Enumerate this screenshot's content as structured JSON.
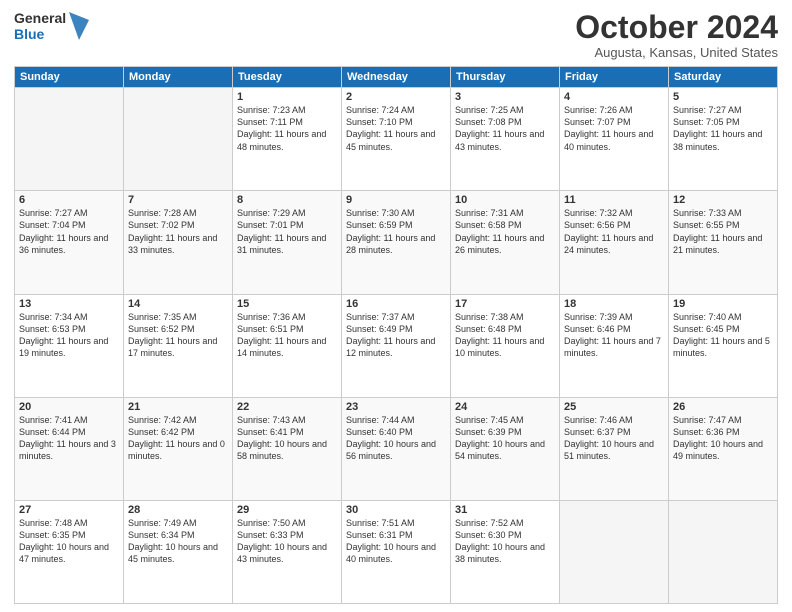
{
  "logo": {
    "line1": "General",
    "line2": "Blue"
  },
  "title": "October 2024",
  "location": "Augusta, Kansas, United States",
  "days_of_week": [
    "Sunday",
    "Monday",
    "Tuesday",
    "Wednesday",
    "Thursday",
    "Friday",
    "Saturday"
  ],
  "weeks": [
    [
      {
        "num": "",
        "empty": true
      },
      {
        "num": "",
        "empty": true
      },
      {
        "num": "1",
        "sunrise": "7:23 AM",
        "sunset": "7:11 PM",
        "daylight": "11 hours and 48 minutes."
      },
      {
        "num": "2",
        "sunrise": "7:24 AM",
        "sunset": "7:10 PM",
        "daylight": "11 hours and 45 minutes."
      },
      {
        "num": "3",
        "sunrise": "7:25 AM",
        "sunset": "7:08 PM",
        "daylight": "11 hours and 43 minutes."
      },
      {
        "num": "4",
        "sunrise": "7:26 AM",
        "sunset": "7:07 PM",
        "daylight": "11 hours and 40 minutes."
      },
      {
        "num": "5",
        "sunrise": "7:27 AM",
        "sunset": "7:05 PM",
        "daylight": "11 hours and 38 minutes."
      }
    ],
    [
      {
        "num": "6",
        "sunrise": "7:27 AM",
        "sunset": "7:04 PM",
        "daylight": "11 hours and 36 minutes."
      },
      {
        "num": "7",
        "sunrise": "7:28 AM",
        "sunset": "7:02 PM",
        "daylight": "11 hours and 33 minutes."
      },
      {
        "num": "8",
        "sunrise": "7:29 AM",
        "sunset": "7:01 PM",
        "daylight": "11 hours and 31 minutes."
      },
      {
        "num": "9",
        "sunrise": "7:30 AM",
        "sunset": "6:59 PM",
        "daylight": "11 hours and 28 minutes."
      },
      {
        "num": "10",
        "sunrise": "7:31 AM",
        "sunset": "6:58 PM",
        "daylight": "11 hours and 26 minutes."
      },
      {
        "num": "11",
        "sunrise": "7:32 AM",
        "sunset": "6:56 PM",
        "daylight": "11 hours and 24 minutes."
      },
      {
        "num": "12",
        "sunrise": "7:33 AM",
        "sunset": "6:55 PM",
        "daylight": "11 hours and 21 minutes."
      }
    ],
    [
      {
        "num": "13",
        "sunrise": "7:34 AM",
        "sunset": "6:53 PM",
        "daylight": "11 hours and 19 minutes."
      },
      {
        "num": "14",
        "sunrise": "7:35 AM",
        "sunset": "6:52 PM",
        "daylight": "11 hours and 17 minutes."
      },
      {
        "num": "15",
        "sunrise": "7:36 AM",
        "sunset": "6:51 PM",
        "daylight": "11 hours and 14 minutes."
      },
      {
        "num": "16",
        "sunrise": "7:37 AM",
        "sunset": "6:49 PM",
        "daylight": "11 hours and 12 minutes."
      },
      {
        "num": "17",
        "sunrise": "7:38 AM",
        "sunset": "6:48 PM",
        "daylight": "11 hours and 10 minutes."
      },
      {
        "num": "18",
        "sunrise": "7:39 AM",
        "sunset": "6:46 PM",
        "daylight": "11 hours and 7 minutes."
      },
      {
        "num": "19",
        "sunrise": "7:40 AM",
        "sunset": "6:45 PM",
        "daylight": "11 hours and 5 minutes."
      }
    ],
    [
      {
        "num": "20",
        "sunrise": "7:41 AM",
        "sunset": "6:44 PM",
        "daylight": "11 hours and 3 minutes."
      },
      {
        "num": "21",
        "sunrise": "7:42 AM",
        "sunset": "6:42 PM",
        "daylight": "11 hours and 0 minutes."
      },
      {
        "num": "22",
        "sunrise": "7:43 AM",
        "sunset": "6:41 PM",
        "daylight": "10 hours and 58 minutes."
      },
      {
        "num": "23",
        "sunrise": "7:44 AM",
        "sunset": "6:40 PM",
        "daylight": "10 hours and 56 minutes."
      },
      {
        "num": "24",
        "sunrise": "7:45 AM",
        "sunset": "6:39 PM",
        "daylight": "10 hours and 54 minutes."
      },
      {
        "num": "25",
        "sunrise": "7:46 AM",
        "sunset": "6:37 PM",
        "daylight": "10 hours and 51 minutes."
      },
      {
        "num": "26",
        "sunrise": "7:47 AM",
        "sunset": "6:36 PM",
        "daylight": "10 hours and 49 minutes."
      }
    ],
    [
      {
        "num": "27",
        "sunrise": "7:48 AM",
        "sunset": "6:35 PM",
        "daylight": "10 hours and 47 minutes."
      },
      {
        "num": "28",
        "sunrise": "7:49 AM",
        "sunset": "6:34 PM",
        "daylight": "10 hours and 45 minutes."
      },
      {
        "num": "29",
        "sunrise": "7:50 AM",
        "sunset": "6:33 PM",
        "daylight": "10 hours and 43 minutes."
      },
      {
        "num": "30",
        "sunrise": "7:51 AM",
        "sunset": "6:31 PM",
        "daylight": "10 hours and 40 minutes."
      },
      {
        "num": "31",
        "sunrise": "7:52 AM",
        "sunset": "6:30 PM",
        "daylight": "10 hours and 38 minutes."
      },
      {
        "num": "",
        "empty": true
      },
      {
        "num": "",
        "empty": true
      }
    ]
  ]
}
